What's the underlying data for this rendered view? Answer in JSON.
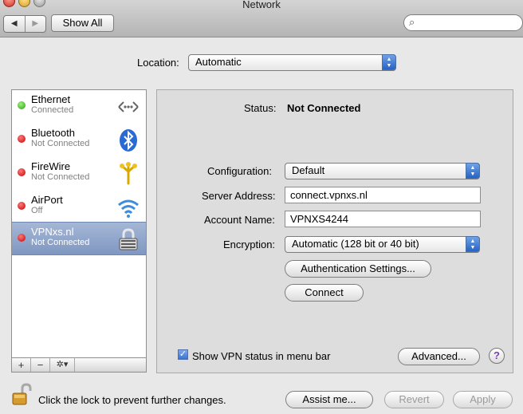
{
  "window": {
    "title": "Network"
  },
  "toolbar": {
    "back": "◀",
    "forward": "▶",
    "show_all": "Show All",
    "search_placeholder": ""
  },
  "location": {
    "label": "Location:",
    "value": "Automatic"
  },
  "services": [
    {
      "name": "Ethernet",
      "status": "Connected",
      "dot": "green",
      "icon": "ethernet-icon",
      "selected": false
    },
    {
      "name": "Bluetooth",
      "status": "Not Connected",
      "dot": "red",
      "icon": "bluetooth-icon",
      "selected": false
    },
    {
      "name": "FireWire",
      "status": "Not Connected",
      "dot": "red",
      "icon": "firewire-icon",
      "selected": false
    },
    {
      "name": "AirPort",
      "status": "Off",
      "dot": "red",
      "icon": "airport-icon",
      "selected": false
    },
    {
      "name": "VPNxs.nl",
      "status": "Not Connected",
      "dot": "red",
      "icon": "vpn-lock-icon",
      "selected": true
    }
  ],
  "sidebar_footer": {
    "add": "+",
    "remove": "−",
    "gear": "✲▾"
  },
  "detail": {
    "status_label": "Status:",
    "status_value": "Not Connected",
    "configuration_label": "Configuration:",
    "configuration_value": "Default",
    "server_label": "Server Address:",
    "server_value": "connect.vpnxs.nl",
    "account_label": "Account Name:",
    "account_value": "VPNXS4244",
    "encryption_label": "Encryption:",
    "encryption_value": "Automatic (128 bit or 40 bit)",
    "auth_button": "Authentication Settings...",
    "connect_button": "Connect",
    "show_vpn_label": "Show VPN status in menu bar",
    "show_vpn_checked": true,
    "advanced_button": "Advanced...",
    "help": "?"
  },
  "bottom": {
    "lock_text": "Click the lock to prevent further changes.",
    "assist_button": "Assist me...",
    "revert_button": "Revert",
    "apply_button": "Apply"
  }
}
